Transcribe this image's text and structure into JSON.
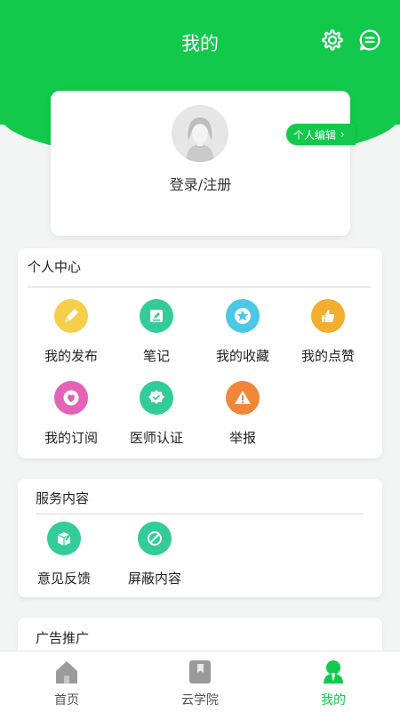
{
  "header": {
    "title": "我的",
    "settings_icon": "gear-icon",
    "message_icon": "chat-icon",
    "bg_color": "#12c94b"
  },
  "profile": {
    "login_text": "登录/注册",
    "edit_label": "个人编辑",
    "avatar_icon": "default-female-avatar"
  },
  "personal_center": {
    "title": "个人中心",
    "items": [
      {
        "label": "我的发布",
        "icon": "pencil-icon",
        "color": "#f5cf4a"
      },
      {
        "label": "笔记",
        "icon": "note-icon",
        "color": "#33cc98"
      },
      {
        "label": "我的收藏",
        "icon": "star-icon",
        "color": "#4cc7e6"
      },
      {
        "label": "我的点赞",
        "icon": "thumbs-up-icon",
        "color": "#f2ae2c"
      },
      {
        "label": "我的订阅",
        "icon": "heart-icon",
        "color": "#e462b8"
      },
      {
        "label": "医师认证",
        "icon": "badge-check-icon",
        "color": "#33cc98"
      },
      {
        "label": "举报",
        "icon": "warning-icon",
        "color": "#f1863a"
      }
    ]
  },
  "services": {
    "title": "服务内容",
    "items": [
      {
        "label": "意见反馈",
        "icon": "feedback-box-icon",
        "color": "#33cc98"
      },
      {
        "label": "屏蔽内容",
        "icon": "block-icon",
        "color": "#33cc98"
      }
    ]
  },
  "ads": {
    "title": "广告推广"
  },
  "tabbar": {
    "items": [
      {
        "label": "首页",
        "icon": "home-icon"
      },
      {
        "label": "云学院",
        "icon": "bookmark-icon"
      },
      {
        "label": "我的",
        "icon": "user-icon",
        "active": true
      }
    ]
  }
}
